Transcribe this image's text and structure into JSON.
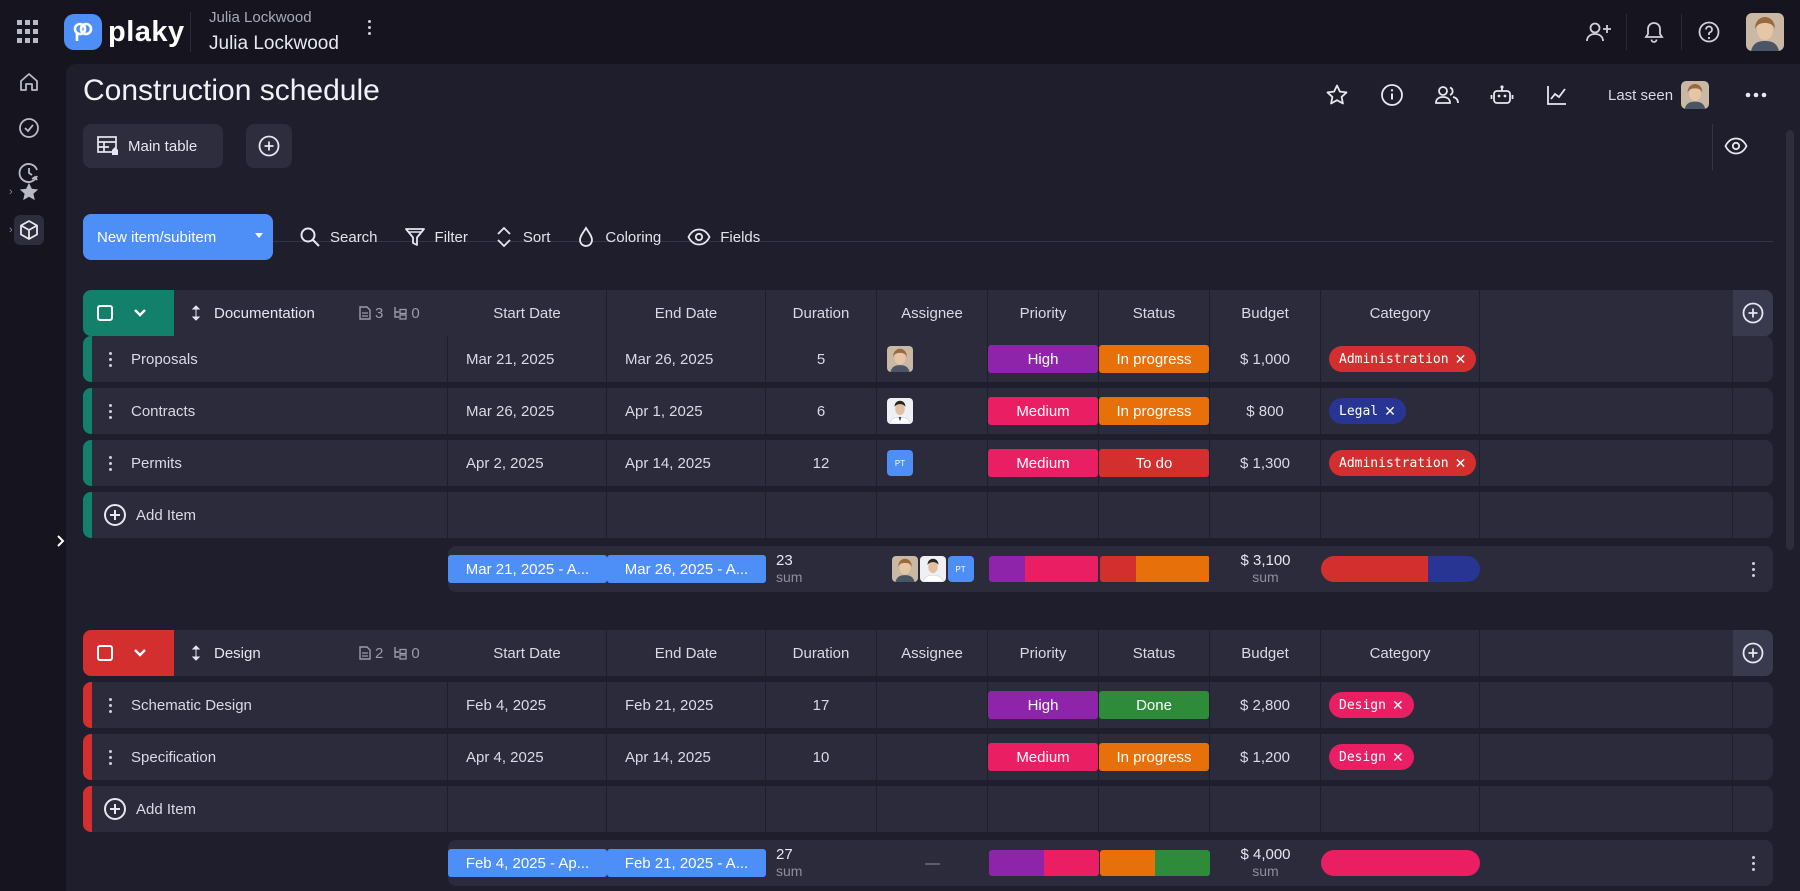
{
  "app": {
    "logo_text": "plaky",
    "workspace_subtitle": "Julia Lockwood",
    "workspace_name": "Julia Lockwood"
  },
  "board": {
    "title": "Construction schedule",
    "last_seen_label": "Last seen"
  },
  "tabs": {
    "main_table": "Main table"
  },
  "toolbar": {
    "new_item": "New item/subitem",
    "search": "Search",
    "filter": "Filter",
    "sort": "Sort",
    "coloring": "Coloring",
    "fields": "Fields"
  },
  "columns": [
    "Start Date",
    "End Date",
    "Duration",
    "Assignee",
    "Priority",
    "Status",
    "Budget",
    "Category"
  ],
  "add_item_label": "Add Item",
  "sum_label": "sum",
  "colors": {
    "priority_high": "#8e24aa",
    "priority_medium": "#e91e63",
    "status_in_progress": "#e8700a",
    "status_to_do": "#d32f2f",
    "status_done": "#2e8b3a",
    "tag_administration": "#d32f2f",
    "tag_legal": "#283593",
    "tag_design": "#e91e63",
    "group_documentation": "#13806b",
    "group_design": "#d32f2f",
    "accent_blue": "#4d8ef7"
  },
  "groups": [
    {
      "name": "Documentation",
      "item_count": "3",
      "subitem_count": "0",
      "items": [
        {
          "name": "Proposals",
          "start": "Mar 21, 2025",
          "end": "Mar 26, 2025",
          "duration": "5",
          "assignee": "photo-woman",
          "priority": "High",
          "status": "In progress",
          "budget": "$ 1,000",
          "category": "Administration"
        },
        {
          "name": "Contracts",
          "start": "Mar 26, 2025",
          "end": "Apr 1, 2025",
          "duration": "6",
          "assignee": "photo-man",
          "priority": "Medium",
          "status": "In progress",
          "budget": "$ 800",
          "category": "Legal"
        },
        {
          "name": "Permits",
          "start": "Apr 2, 2025",
          "end": "Apr 14, 2025",
          "duration": "12",
          "assignee": "PT",
          "priority": "Medium",
          "status": "To do",
          "budget": "$ 1,300",
          "category": "Administration"
        }
      ],
      "summary": {
        "start": "Mar 21, 2025 - A...",
        "end": "Mar 26, 2025 - A...",
        "duration": "23",
        "budget": "$ 3,100"
      }
    },
    {
      "name": "Design",
      "item_count": "2",
      "subitem_count": "0",
      "items": [
        {
          "name": "Schematic Design",
          "start": "Feb 4, 2025",
          "end": "Feb 21, 2025",
          "duration": "17",
          "assignee": "",
          "priority": "High",
          "status": "Done",
          "budget": "$ 2,800",
          "category": "Design"
        },
        {
          "name": "Specification",
          "start": "Apr 4, 2025",
          "end": "Apr 14, 2025",
          "duration": "10",
          "assignee": "",
          "priority": "Medium",
          "status": "In progress",
          "budget": "$ 1,200",
          "category": "Design"
        }
      ],
      "summary": {
        "start": "Feb 4, 2025 - Ap...",
        "end": "Feb 21, 2025 - A...",
        "duration": "27",
        "budget": "$ 4,000",
        "assignee": "—"
      }
    }
  ],
  "assignee_initials": "PT",
  "tag_close": "✕"
}
